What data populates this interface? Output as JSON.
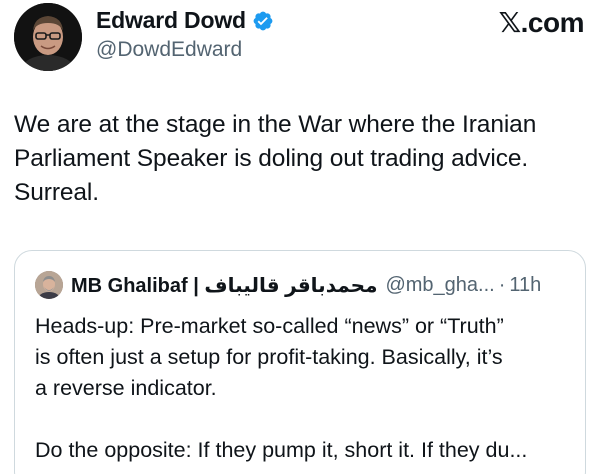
{
  "author": {
    "name": "Edward Dowd",
    "handle": "@DowdEdward",
    "verified": true,
    "verified_color": "#1d9bf0"
  },
  "source": {
    "x_glyph": "𝕏",
    "domain": ".com"
  },
  "tweet": {
    "lines": [
      "We are at the stage in the War where the Iranian",
      "Parliament Speaker is doling out trading advice.",
      "Surreal."
    ]
  },
  "quoted": {
    "name": "MB Ghalibaf | محمدباقر قالیباف",
    "handle": "@mb_gha...",
    "separator": "·",
    "time": "11h",
    "paragraph1": [
      "Heads-up: Pre-market so-called “news” or “Truth”",
      "is often just a setup for profit-taking. Basically, it’s",
      "a reverse indicator."
    ],
    "paragraph2": [
      "Do the opposite: If they pump it, short it. If they du..."
    ]
  },
  "colors": {
    "text": "#0f1419",
    "secondary": "#536471",
    "border": "#cfd9de"
  },
  "icons": {
    "verified": "verified-badge-icon",
    "avatar": "author-avatar",
    "quoted_avatar": "quoted-author-avatar"
  }
}
